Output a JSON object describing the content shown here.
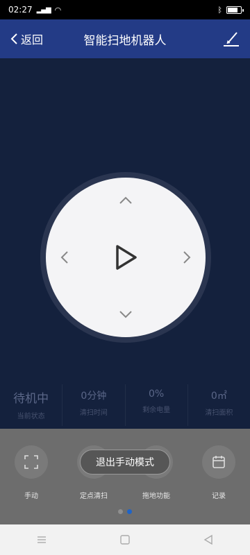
{
  "status_bar": {
    "time": "02:27",
    "signal": "📶",
    "battery_level": 0.8
  },
  "header": {
    "back_label": "返回",
    "title": "智能扫地机器人"
  },
  "stats": [
    {
      "value": "待机中",
      "label": "当前状态"
    },
    {
      "value": "0分钟",
      "label": "清扫时间"
    },
    {
      "value": "0%",
      "label": "剩余电量"
    },
    {
      "value": "0㎡",
      "label": "清扫面积"
    }
  ],
  "functions": [
    {
      "label": "手动",
      "icon": "manual-frame-icon"
    },
    {
      "label": "定点清扫",
      "icon": "spot-clean-icon"
    },
    {
      "label": "拖地功能",
      "icon": "mop-icon"
    },
    {
      "label": "记录",
      "icon": "calendar-icon"
    }
  ],
  "toast": {
    "label": "退出手动模式"
  },
  "pagination": {
    "count": 2,
    "active_index": 1
  },
  "colors": {
    "header": "#233b86",
    "main_bg": "#14213d",
    "panel": "#6d6d6d",
    "active_dot": "#1f64c8"
  }
}
